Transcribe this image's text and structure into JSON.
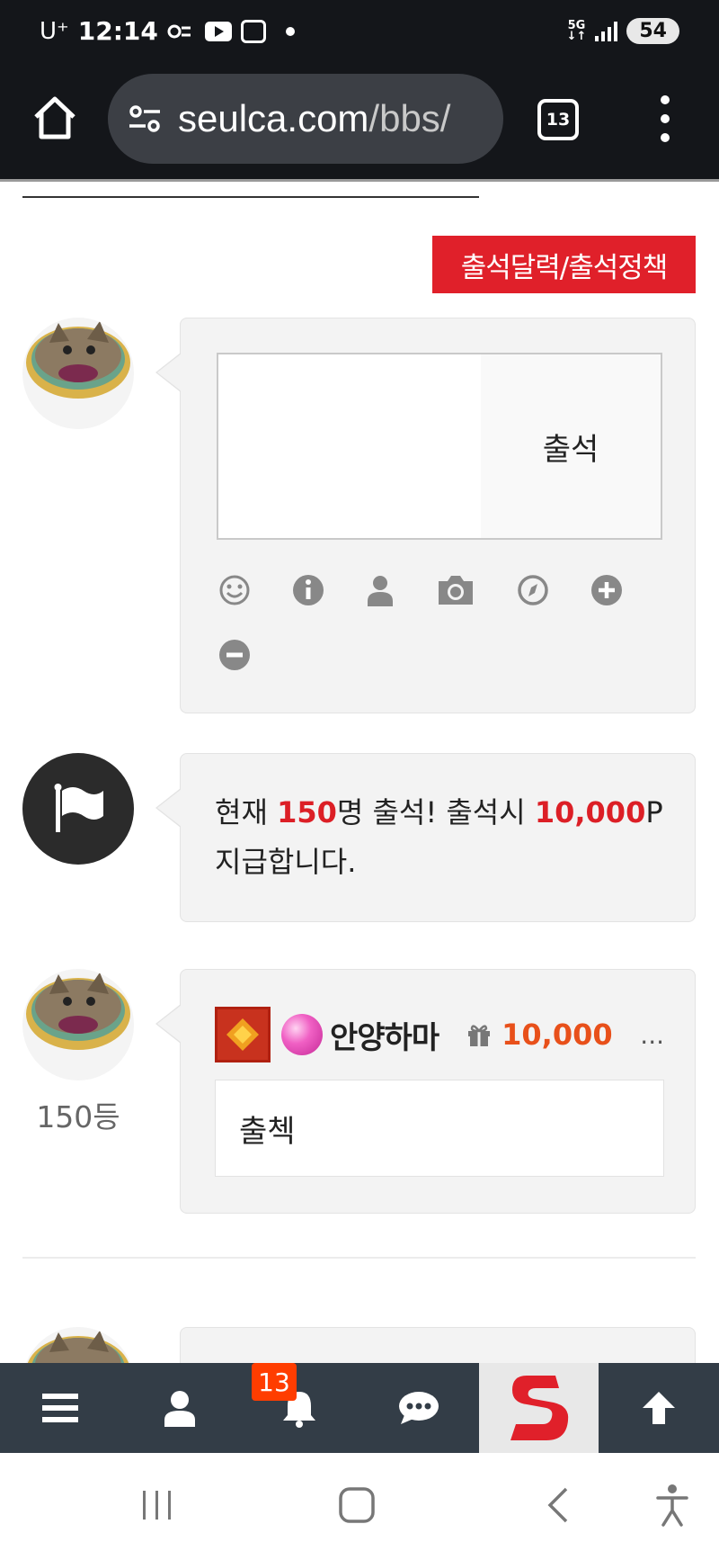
{
  "status_bar": {
    "carrier": "U⁺",
    "time": "12:14",
    "network": "5G",
    "battery": "54"
  },
  "browser": {
    "url_host": "seulca.com",
    "url_path": "/bbs/",
    "tab_count": "13"
  },
  "page": {
    "policy_button": "출석달력/출석정책",
    "attend_button": "출석",
    "comment_placeholder": "",
    "tools": [
      "smile-icon",
      "info-icon",
      "user-icon",
      "camera-icon",
      "compass-icon",
      "plus-icon",
      "minus-icon"
    ],
    "notice": {
      "part1": "현재 ",
      "count": "150",
      "part2": "명 출석! 출석시 ",
      "points": "10,000",
      "part3": "P 지급합니다."
    },
    "entry": {
      "nickname": "안양하마",
      "points": "10,000",
      "more": "...",
      "message": "출첵",
      "rank": "150등"
    }
  },
  "bottom_nav": {
    "notification_count": "13",
    "items": [
      "menu-icon",
      "user-icon",
      "bell-icon",
      "chat-icon",
      "site-logo",
      "arrow-up-icon"
    ]
  },
  "colors": {
    "accent_red": "#e0202a",
    "points_orange": "#e8501a",
    "nav_bg": "#333d47"
  }
}
